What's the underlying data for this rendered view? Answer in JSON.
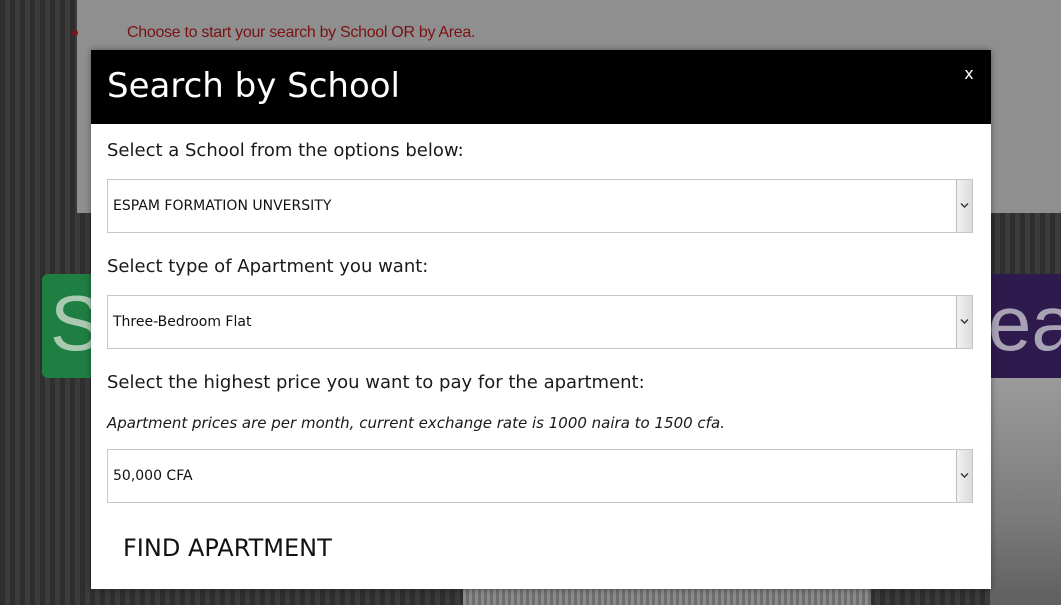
{
  "background": {
    "instruction": "Choose to start your search by School OR by Area.",
    "tile_left_letter": "S",
    "tile_right_letters": "ea"
  },
  "modal": {
    "title": "Search by School",
    "close_label": "x",
    "school": {
      "label": "Select a School from the options below:",
      "selected": "ESPAM FORMATION UNVERSITY"
    },
    "apartment_type": {
      "label": "Select type of Apartment you want:",
      "selected": "Three-Bedroom Flat"
    },
    "price": {
      "label": "Select the highest price you want to pay for the apartment:",
      "note": "Apartment prices are per month, current exchange rate is 1000 naira to 1500 cfa.",
      "selected": "50,000 CFA"
    },
    "submit_label": "FIND APARTMENT"
  },
  "colors": {
    "header_bg": "#000000",
    "instruction_text": "#7a1212",
    "tile_left": "#1f7e42",
    "tile_right": "#2e1a4d"
  }
}
